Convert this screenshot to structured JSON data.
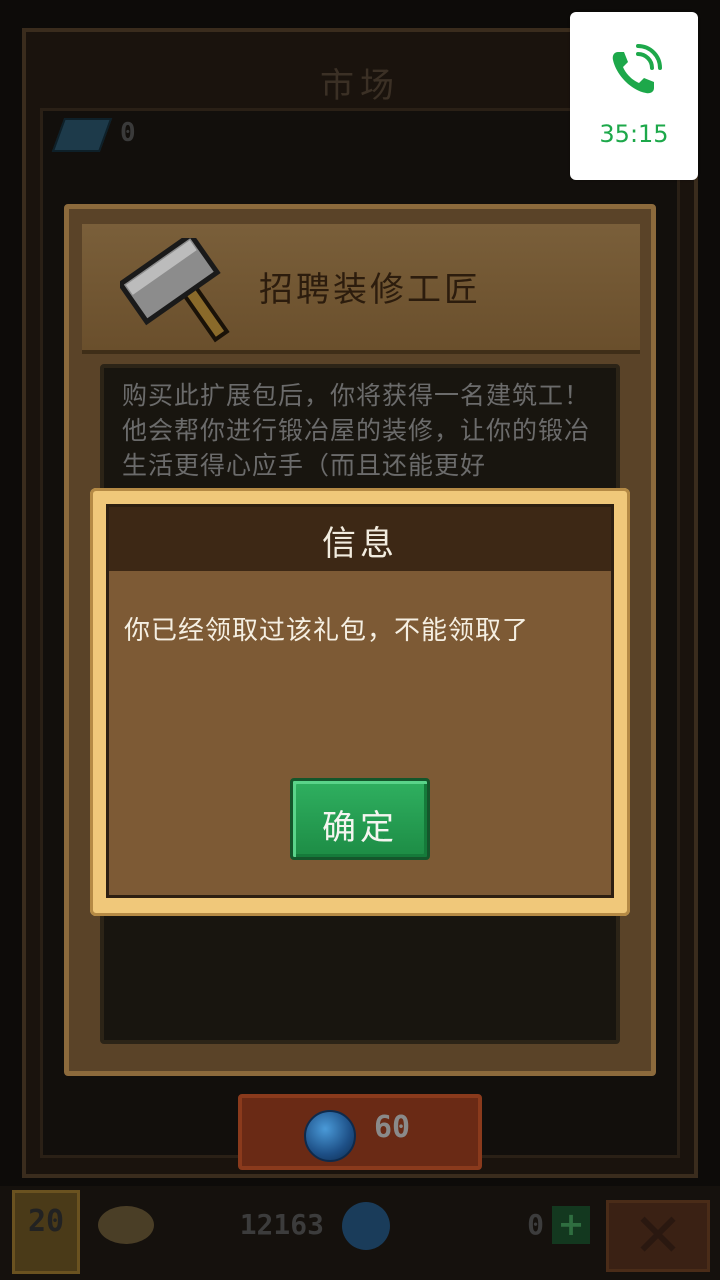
{
  "background_panel": {
    "title": "市场",
    "gem_count": "0"
  },
  "item_dialog": {
    "title": "招聘装修工匠",
    "icon": "hammer-icon",
    "description": "购买此扩展包后，你将获得一名建筑工！他会帮你进行锻冶屋的装修，让你的锻冶生活更得心应手（而且还能更好"
  },
  "buy_button": {
    "currency_icon": "gem-icon",
    "price": "60"
  },
  "info_dialog": {
    "title": "信息",
    "message": "你已经领取过该礼包，不能领取了",
    "confirm_label": "确定"
  },
  "bottom_bar": {
    "level": "20",
    "gold": "12163",
    "gems": "0",
    "plus_label": "+",
    "close_label": "✕"
  },
  "call_widget": {
    "icon": "phone-icon",
    "duration": "35:15"
  },
  "colors": {
    "confirm_green": "#1d8c45",
    "dialog_border": "#f0c87a",
    "call_green": "#1da84a"
  }
}
